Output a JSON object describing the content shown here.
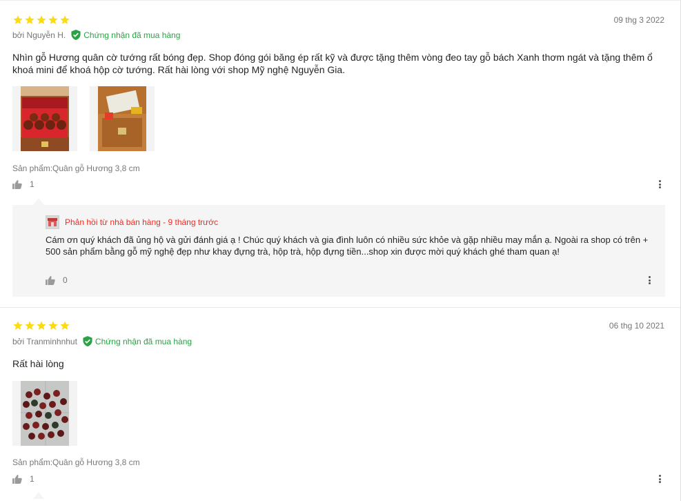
{
  "reviews": [
    {
      "rating": 5,
      "date": "09 thg 3 2022",
      "author": "bởi Nguyễn H.",
      "verified": "Chứng nhận đã mua hàng",
      "content": "Nhìn gỗ Hương quân cờ tướng rất bóng đẹp. Shop đóng gói băng ép rất kỹ và được tặng thêm vòng đeo tay gỗ bách Xanh thơm ngát và tặng thêm ổ khoá mini để khoá hộp cờ tướng. Rất hài lòng với shop Mỹ nghệ Nguyễn Gia.",
      "variant": "Sản phẩm:Quân gỗ Hương 3,8 cm",
      "likes": "1",
      "reply": {
        "header": "Phản hồi từ nhà bán hàng - 9 tháng trước",
        "text": "Cám ơn quý khách đã ủng hộ và gửi đánh giá ạ ! Chúc quý khách và gia đình luôn có nhiều sức khỏe và gặp nhiều may mắn ạ. Ngoài ra shop có trên + 500 sản phẩm bằng gỗ mỹ nghệ đẹp như khay đựng trà, hộp trà, hộp đựng tiền...shop xin được mời quý khách ghé tham quan ạ!",
        "likes": "0"
      }
    },
    {
      "rating": 5,
      "date": "06 thg 10 2021",
      "author": "bởi Tranminhnhut",
      "verified": "Chứng nhận đã mua hàng",
      "content": "Rất hài lòng",
      "variant": "Sản phẩm:Quân gỗ Hương 3,8 cm",
      "likes": "1"
    }
  ],
  "colors": {
    "star": "#fadb14",
    "verified": "#2ba245",
    "seller": "#ee2d24"
  },
  "icons": {
    "star": "star-icon",
    "verified": "verified-shield-icon",
    "like": "thumbs-up-icon",
    "more": "more-vertical-icon",
    "seller": "seller-shop-icon"
  }
}
